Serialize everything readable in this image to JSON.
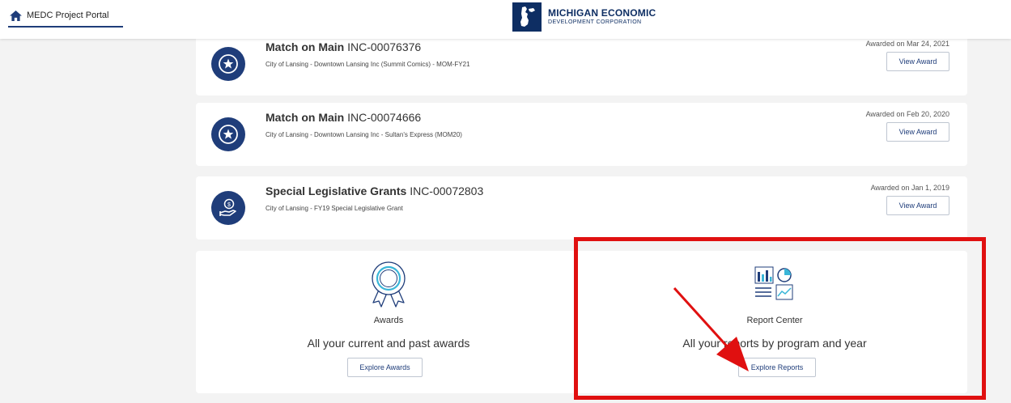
{
  "header": {
    "home_label": "MEDC Project Portal",
    "logo_line1": "MICHIGAN ECONOMIC",
    "logo_line2": "DEVELOPMENT CORPORATION"
  },
  "awards": [
    {
      "program": "Match on Main",
      "id": "INC-00076376",
      "subtitle": "City of Lansing - Downtown Lansing Inc (Summit Comics) - MOM-FY21",
      "date": "Awarded on Mar 24, 2021",
      "button": "View Award",
      "icon": "star-icon"
    },
    {
      "program": "Match on Main",
      "id": "INC-00074666",
      "subtitle": "City of Lansing - Downtown Lansing Inc - Sultan's Express (MOM20)",
      "date": "Awarded on Feb 20, 2020",
      "button": "View Award",
      "icon": "star-icon"
    },
    {
      "program": "Special Legislative Grants",
      "id": "INC-00072803",
      "subtitle": "City of Lansing - FY19 Special Legislative Grant",
      "date": "Awarded on Jan 1, 2019",
      "button": "View Award",
      "icon": "hand-money-icon"
    }
  ],
  "panels": {
    "awards": {
      "label": "Awards",
      "description": "All your current and past awards",
      "button": "Explore Awards",
      "icon": "ribbon-icon"
    },
    "reports": {
      "label": "Report Center",
      "description": "All your reports by program and year",
      "button": "Explore Reports",
      "icon": "report-charts-icon"
    }
  },
  "colors": {
    "brand_navy": "#1f3d7a",
    "annotation_red": "#e01010",
    "background": "#f3f3f3"
  }
}
